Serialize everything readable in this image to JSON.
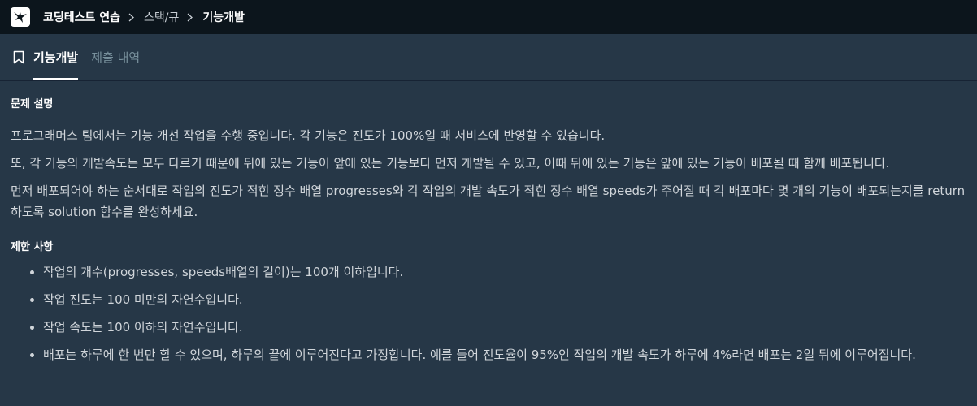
{
  "breadcrumb": {
    "items": [
      "코딩테스트 연습",
      "스택/큐",
      "기능개발"
    ]
  },
  "tabs": {
    "active_label": "기능개발",
    "submissions_label": "제출 내역"
  },
  "problem": {
    "description_title": "문제 설명",
    "paragraphs": [
      "프로그래머스 팀에서는 기능 개선 작업을 수행 중입니다. 각 기능은 진도가 100%일 때 서비스에 반영할 수 있습니다.",
      "또, 각 기능의 개발속도는 모두 다르기 때문에 뒤에 있는 기능이 앞에 있는 기능보다 먼저 개발될 수 있고, 이때 뒤에 있는 기능은 앞에 있는 기능이 배포될 때 함께 배포됩니다.",
      "먼저 배포되어야 하는 순서대로 작업의 진도가 적힌 정수 배열 progresses와 각 작업의 개발 속도가 적힌 정수 배열 speeds가 주어질 때 각 배포마다 몇 개의 기능이 배포되는지를 return 하도록 solution 함수를 완성하세요."
    ],
    "constraints_title": "제한 사항",
    "constraints": [
      "작업의 개수(progresses, speeds배열의 길이)는 100개 이하입니다.",
      "작업 진도는 100 미만의 자연수입니다.",
      "작업 속도는 100 이하의 자연수입니다.",
      "배포는 하루에 한 번만 할 수 있으며, 하루의 끝에 이루어진다고 가정합니다. 예를 들어 진도율이 95%인 작업의 개발 속도가 하루에 4%라면 배포는 2일 뒤에 이루어집니다."
    ]
  },
  "colors": {
    "topbar_bg": "#0c151c",
    "page_bg": "#263747",
    "text": "#d0d5da",
    "inactive_tab": "#78909c"
  }
}
